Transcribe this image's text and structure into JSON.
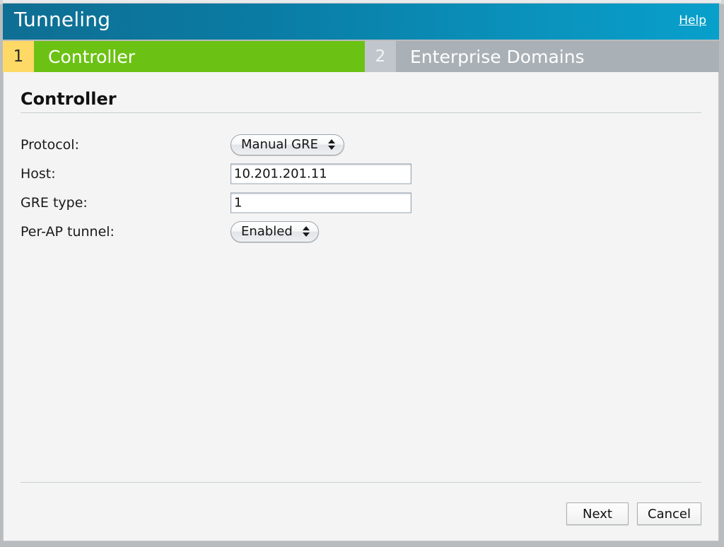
{
  "window": {
    "title": "Tunneling",
    "help_link": "Help"
  },
  "wizard": {
    "steps": [
      {
        "number": "1",
        "label": "Controller",
        "state": "active"
      },
      {
        "number": "2",
        "label": "Enterprise Domains",
        "state": "inactive"
      }
    ]
  },
  "section": {
    "title": "Controller"
  },
  "form": {
    "fields": [
      {
        "label": "Protocol:",
        "type": "select",
        "value": "Manual GRE",
        "icon": "updown-arrows-icon"
      },
      {
        "label": "Host:",
        "type": "text",
        "value": "10.201.201.11",
        "placeholder": ""
      },
      {
        "label": "GRE type:",
        "type": "text",
        "value": "1",
        "placeholder": ""
      },
      {
        "label": "Per-AP tunnel:",
        "type": "select",
        "value": "Enabled",
        "icon": "updown-arrows-icon"
      }
    ]
  },
  "footer": {
    "next_label": "Next",
    "cancel_label": "Cancel"
  },
  "colors": {
    "titlebar_left": "#0f6e93",
    "titlebar_right": "#07a0cb",
    "step_active_bar": "#6cc214",
    "step_active_badge": "#ffd966",
    "step_inactive_bar": "#a9b0b6",
    "step_inactive_badge": "#c0c6cb",
    "content_bg": "#f4f4f4",
    "page_bg": "#b9bcbe"
  }
}
